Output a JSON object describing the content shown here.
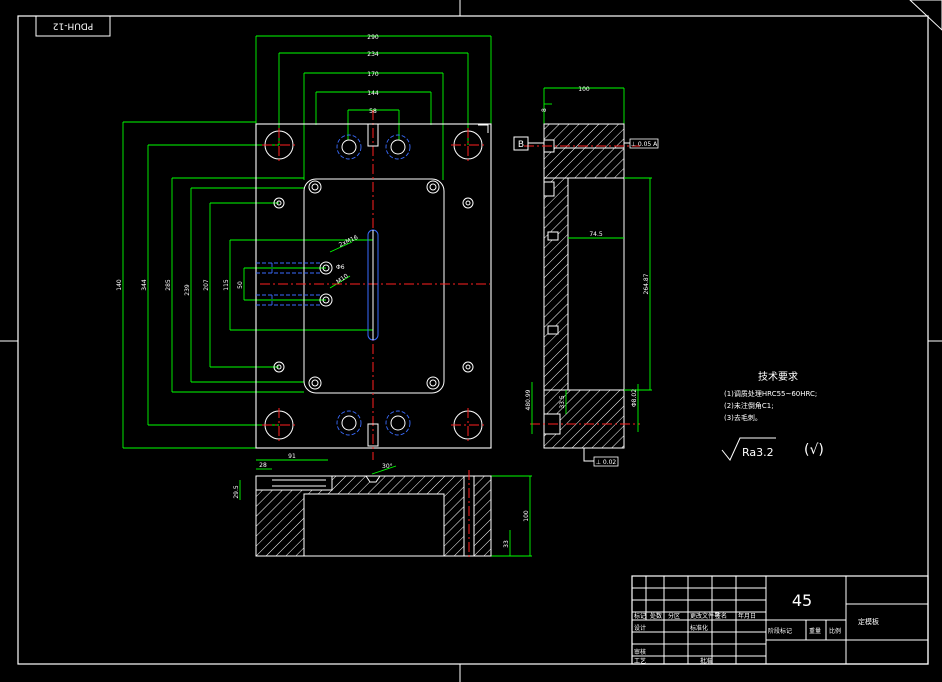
{
  "drawing": {
    "code_tag": "PDUH-12",
    "tech_requirements": {
      "title": "技术要求",
      "items": [
        "(1)调质处理HRC55~60HRC;",
        "(2)未注倒角C1;",
        "(3)去毛刺。"
      ]
    },
    "roughness": {
      "value": "Ra3.2",
      "other": "(√)"
    },
    "section_label": "B",
    "datum_ref_top": "⊥ 0.05 A",
    "datum_ref_bottom": "⊥ 0.02",
    "dimensions": {
      "top_widths": [
        "290",
        "234",
        "170",
        "144",
        "58"
      ],
      "left_heights": [
        "140",
        "344",
        "285",
        "239",
        "207",
        "115",
        "50"
      ],
      "side_width": "100",
      "side_small": "8",
      "side_inner": "74.5",
      "side_height": "264.87",
      "side_low_1": "480.99",
      "side_low_2": "33.5",
      "side_low_3": "Φ8.02",
      "bottom_1": "91",
      "bottom_2": "28",
      "bottom_3": "30°",
      "bottom_4": "10",
      "bottom_height": "100",
      "bottom_left": "29.5",
      "bottom_right": "33",
      "hole_labels": [
        "2xM16",
        "Φ6",
        "M10"
      ]
    },
    "title_block": {
      "material": "45",
      "part_name": "定模板",
      "row_labels": [
        "标记",
        "处数",
        "分区",
        "更改文件号",
        "签名",
        "年月日"
      ],
      "left_labels": [
        "设计",
        "审核",
        "工艺",
        "标准化",
        "批准"
      ],
      "stage_labels": [
        "阶段标记",
        "重量",
        "比例"
      ]
    }
  }
}
